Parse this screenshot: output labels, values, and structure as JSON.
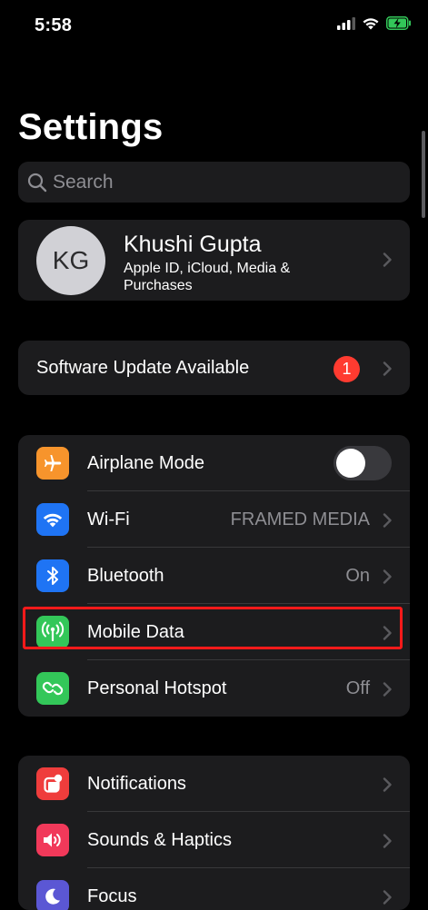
{
  "status_bar": {
    "time": "5:58"
  },
  "header": {
    "title": "Settings"
  },
  "search": {
    "placeholder": "Search"
  },
  "profile": {
    "initials": "KG",
    "name": "Khushi Gupta",
    "subtitle": "Apple ID, iCloud, Media & Purchases"
  },
  "software_update": {
    "label": "Software Update Available",
    "badge": "1"
  },
  "connectivity": [
    {
      "label": "Airplane Mode",
      "icon": "airplane-icon",
      "color": "#f7942c",
      "toggle_on": false
    },
    {
      "label": "Wi-Fi",
      "value": "FRAMED MEDIA",
      "icon": "wifi-icon",
      "color": "#1f74f4"
    },
    {
      "label": "Bluetooth",
      "value": "On",
      "icon": "bluetooth-icon",
      "color": "#1f74f4"
    },
    {
      "label": "Mobile Data",
      "icon": "antenna-icon",
      "color": "#33c759",
      "highlighted": true
    },
    {
      "label": "Personal Hotspot",
      "value": "Off",
      "icon": "hotspot-icon",
      "color": "#33c759"
    }
  ],
  "general": [
    {
      "label": "Notifications",
      "icon": "notifications-icon",
      "color": "#ef3d3c"
    },
    {
      "label": "Sounds & Haptics",
      "icon": "speaker-icon",
      "color": "#f1395a"
    },
    {
      "label": "Focus",
      "icon": "moon-icon",
      "color": "#5b57d4"
    }
  ],
  "colors": {
    "highlight": "#ff1a1a",
    "background": "#000000",
    "card": "#1c1c1e"
  }
}
